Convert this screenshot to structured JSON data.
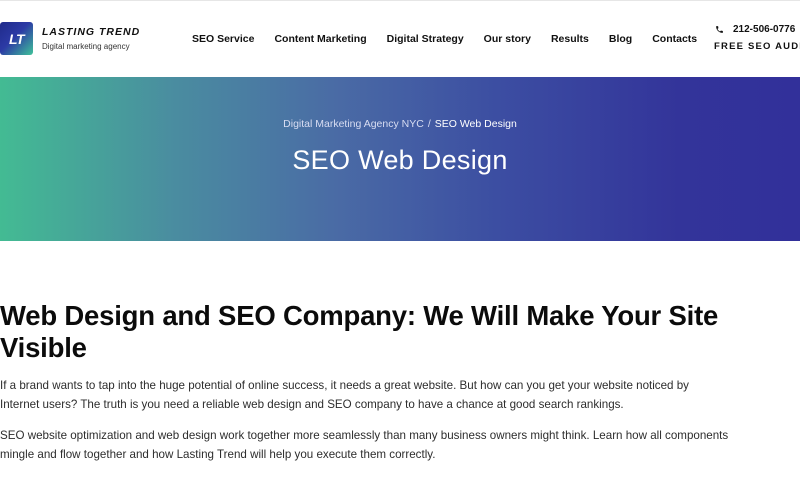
{
  "header": {
    "logo_mark": "LT",
    "logo_name": "LASTING TREND",
    "logo_tagline": "Digital marketing agency",
    "nav": [
      {
        "label": "SEO Service"
      },
      {
        "label": "Content Marketing"
      },
      {
        "label": "Digital Strategy"
      },
      {
        "label": "Our story"
      },
      {
        "label": "Results"
      },
      {
        "label": "Blog"
      },
      {
        "label": "Contacts"
      }
    ],
    "phone": "212-506-0776",
    "cta": "FREE SEO AUDIT",
    "phone_icon": "phone-icon"
  },
  "hero": {
    "breadcrumb_parent": "Digital Marketing Agency NYC",
    "breadcrumb_separator": "/",
    "breadcrumb_current": "SEO Web Design",
    "title": "SEO Web Design",
    "gradient_start": "#43bb93",
    "gradient_end": "#32309a"
  },
  "main": {
    "heading_line1": "Web Design and SEO Company: We Will Make Your Site",
    "heading_line2": "Visible",
    "p1_line1": "If a brand wants to tap into the huge potential of online success, it needs a great website. But how can you get your website noticed by",
    "p1_line2": "Internet users? The truth is you need a reliable web design and SEO company to have a chance at good search rankings.",
    "p2_line1": "SEO website optimization and web design work together more seamlessly than many business owners might think. Learn how all components",
    "p2_line2": "mingle and flow together and how Lasting Trend will help you execute them correctly."
  }
}
